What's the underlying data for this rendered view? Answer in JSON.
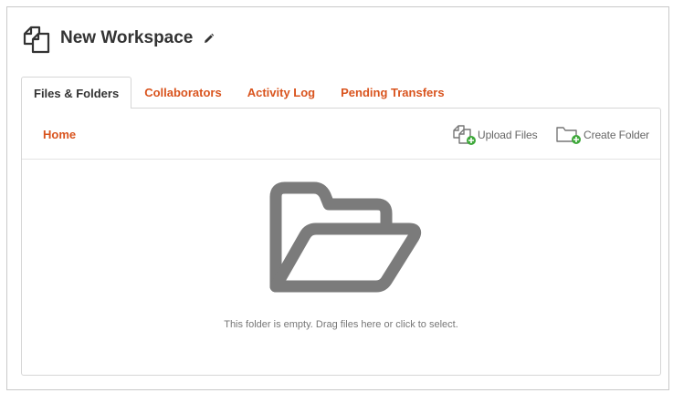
{
  "workspace": {
    "title": "New Workspace"
  },
  "tabs": [
    {
      "label": "Files & Folders",
      "active": true
    },
    {
      "label": "Collaborators",
      "active": false
    },
    {
      "label": "Activity Log",
      "active": false
    },
    {
      "label": "Pending Transfers",
      "active": false
    }
  ],
  "toolbar": {
    "breadcrumb": "Home",
    "upload_label": "Upload Files",
    "create_label": "Create Folder"
  },
  "dropzone": {
    "message": "This folder is empty. Drag files here or click to select."
  },
  "colors": {
    "accent": "#d9541e",
    "plus_badge": "#3ea83a",
    "icon_gray": "#7b7b7b"
  },
  "icons": [
    "documents-icon",
    "pencil-icon",
    "upload-files-icon",
    "create-folder-icon",
    "open-folder-icon"
  ]
}
